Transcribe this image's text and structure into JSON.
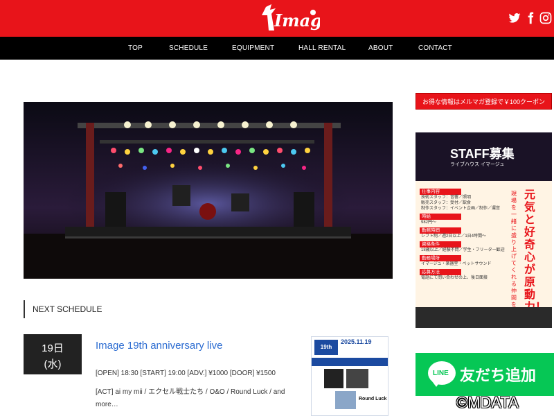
{
  "header": {
    "logo_alt": "Image",
    "social": [
      "twitter-icon",
      "facebook-icon",
      "instagram-icon"
    ],
    "colors": {
      "brand_red": "#e8141a",
      "nav_bg": "#000000"
    }
  },
  "nav": {
    "items": [
      "TOP",
      "SCHEDULE",
      "EQUIPMENT",
      "HALL RENTAL",
      "ABOUT",
      "CONTACT"
    ]
  },
  "schedule": {
    "heading": "NEXT SCHEDULE",
    "event": {
      "date_day": "19日",
      "date_weekday": "(水)",
      "title": "Image 19th anniversary live",
      "details_line1": "[OPEN] 18:30 [START] 19:00 [ADV.] ¥1000 [DOOR] ¥1500",
      "details_line2": "[ACT] ai my mii / エクセル戦士たち / O&O / Round Luck / and",
      "details_line3": "more…",
      "flyer": {
        "date": "2025.11.19",
        "badge": "19th",
        "act_label": "Round Luck"
      }
    }
  },
  "sidebar": {
    "promo_text": "お得な情報はメルマガ登録で￥100クーポン",
    "staff": {
      "title": "STAFF募集",
      "subtitle": "ライブハウス イマージュ",
      "sections": [
        {
          "head": "仕事内容",
          "lines": [
            "技術スタッフ：音響／照明",
            "販売スタッフ：受付／飲食",
            "制作スタッフ：イベント企画／制作／運営"
          ]
        },
        {
          "head": "時給",
          "lines": [
            "982円〜"
          ]
        },
        {
          "head": "勤務時間",
          "lines": [
            "シフト制／週2日以上／1日4時間〜"
          ]
        },
        {
          "head": "資格条件",
          "lines": [
            "18歳以上／経験不問／学生・フリーター歓迎"
          ]
        },
        {
          "head": "勤務場所",
          "lines": [
            "イマージュ・楽器堂・ペットサウンド"
          ]
        },
        {
          "head": "応募方法",
          "lines": [
            "電話にて問い合わせの上、後日面接"
          ]
        }
      ],
      "slogan": "元気と好奇心が原動力！",
      "slogan_sub": "現場を一緒に盛り上げてくれる仲間を募集中！"
    },
    "line_banner": {
      "bubble_text": "LINE",
      "label": "友だち追加"
    }
  },
  "watermark": "©MDATA"
}
